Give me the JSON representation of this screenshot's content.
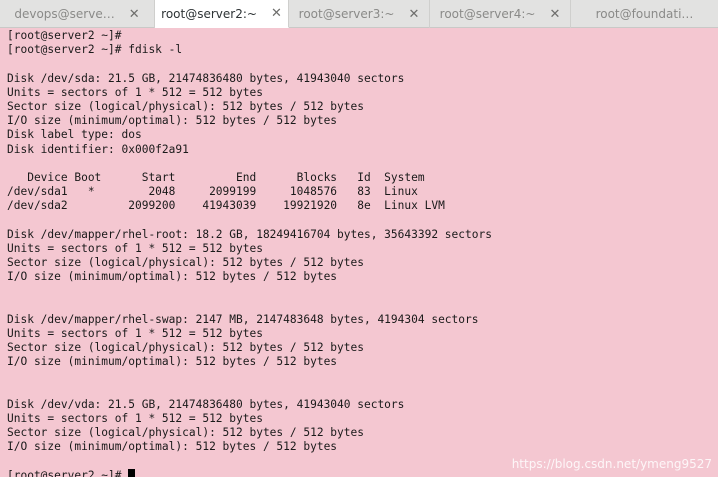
{
  "tabs": [
    {
      "label": "devops@serve…",
      "close": "✕"
    },
    {
      "label": "root@server2:~",
      "close": "✕"
    },
    {
      "label": "root@server3:~",
      "close": "✕"
    },
    {
      "label": "root@server4:~",
      "close": "✕"
    },
    {
      "label": "root@foundati…",
      "close": ""
    }
  ],
  "active_tab": 1,
  "colors": {
    "terminal_bg": "#f4c7d1",
    "terminal_fg": "#1a1a1a"
  },
  "terminal": {
    "lines": [
      "[root@server2 ~]#",
      "[root@server2 ~]# fdisk -l",
      "",
      "Disk /dev/sda: 21.5 GB, 21474836480 bytes, 41943040 sectors",
      "Units = sectors of 1 * 512 = 512 bytes",
      "Sector size (logical/physical): 512 bytes / 512 bytes",
      "I/O size (minimum/optimal): 512 bytes / 512 bytes",
      "Disk label type: dos",
      "Disk identifier: 0x000f2a91",
      "",
      "   Device Boot      Start         End      Blocks   Id  System",
      "/dev/sda1   *        2048     2099199     1048576   83  Linux",
      "/dev/sda2         2099200    41943039    19921920   8e  Linux LVM",
      "",
      "Disk /dev/mapper/rhel-root: 18.2 GB, 18249416704 bytes, 35643392 sectors",
      "Units = sectors of 1 * 512 = 512 bytes",
      "Sector size (logical/physical): 512 bytes / 512 bytes",
      "I/O size (minimum/optimal): 512 bytes / 512 bytes",
      "",
      "",
      "Disk /dev/mapper/rhel-swap: 2147 MB, 2147483648 bytes, 4194304 sectors",
      "Units = sectors of 1 * 512 = 512 bytes",
      "Sector size (logical/physical): 512 bytes / 512 bytes",
      "I/O size (minimum/optimal): 512 bytes / 512 bytes",
      "",
      "",
      "Disk /dev/vda: 21.5 GB, 21474836480 bytes, 41943040 sectors",
      "Units = sectors of 1 * 512 = 512 bytes",
      "Sector size (logical/physical): 512 bytes / 512 bytes",
      "I/O size (minimum/optimal): 512 bytes / 512 bytes",
      "",
      "[root@server2 ~]# "
    ]
  },
  "watermark": "https://blog.csdn.net/ymeng9527"
}
